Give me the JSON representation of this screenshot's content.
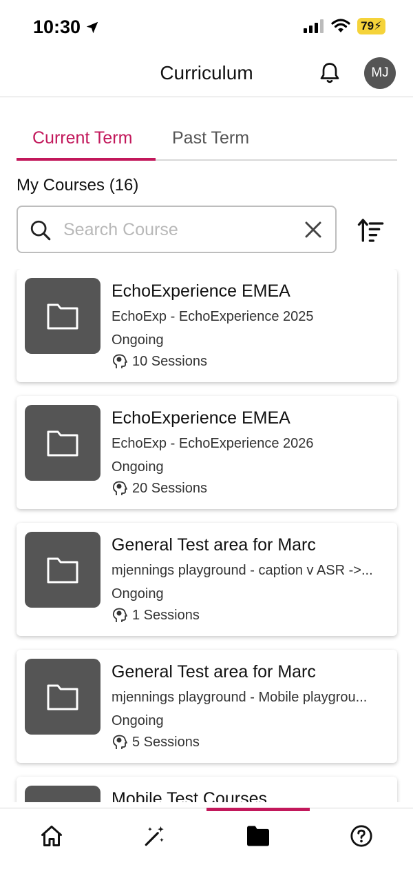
{
  "status_bar": {
    "time": "10:30",
    "battery": "79"
  },
  "header": {
    "title": "Curriculum",
    "avatar_initials": "MJ"
  },
  "tabs": [
    {
      "label": "Current Term",
      "active": true
    },
    {
      "label": "Past Term",
      "active": false
    }
  ],
  "section_title": "My Courses (16)",
  "search": {
    "placeholder": "Search Course",
    "value": ""
  },
  "courses": [
    {
      "title": "EchoExperience EMEA",
      "subtitle": "EchoExp - EchoExperience 2025",
      "status": "Ongoing",
      "sessions": "10 Sessions"
    },
    {
      "title": "EchoExperience EMEA",
      "subtitle": "EchoExp - EchoExperience 2026",
      "status": "Ongoing",
      "sessions": "20 Sessions"
    },
    {
      "title": "General Test area for Marc",
      "subtitle": "mjennings playground - caption v ASR ->...",
      "status": "Ongoing",
      "sessions": "1 Sessions"
    },
    {
      "title": "General Test area for Marc",
      "subtitle": "mjennings playground - Mobile playgrou...",
      "status": "Ongoing",
      "sessions": "5 Sessions"
    },
    {
      "title": "Mobile Test Courses",
      "subtitle": "",
      "status": "",
      "sessions": ""
    }
  ],
  "bottom_nav": [
    {
      "icon": "home-icon",
      "active": false
    },
    {
      "icon": "magic-wand-icon",
      "active": false
    },
    {
      "icon": "folder-icon",
      "active": true
    },
    {
      "icon": "help-icon",
      "active": false
    }
  ],
  "colors": {
    "accent": "#c2185b",
    "thumb": "#555555",
    "battery": "#f5d33a"
  }
}
